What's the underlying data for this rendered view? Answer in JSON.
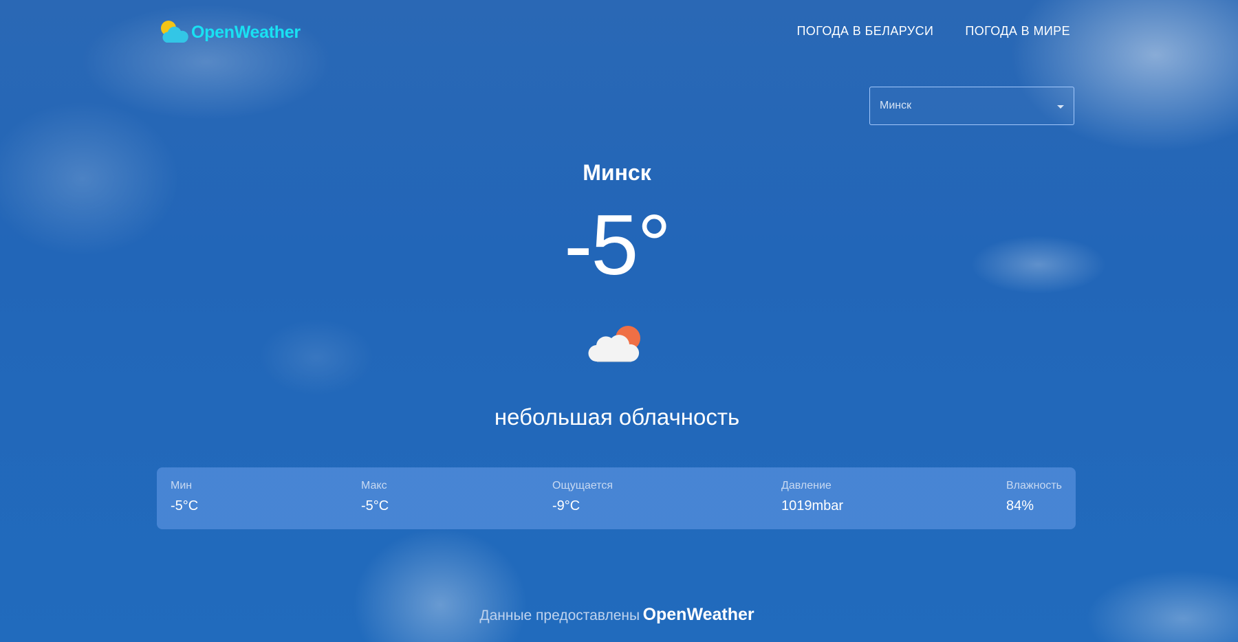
{
  "header": {
    "brand": "OpenWeather",
    "nav": [
      {
        "label": "ПОГОДА В БЕЛАРУСИ"
      },
      {
        "label": "ПОГОДА В МИРЕ"
      }
    ]
  },
  "city_select": {
    "value": "Минск"
  },
  "current": {
    "city": "Минск",
    "temperature": "-5°",
    "description": "небольшая облачность",
    "icon": "partly-cloudy-icon"
  },
  "stats": [
    {
      "label": "Мин",
      "value": "-5°C"
    },
    {
      "label": "Макс",
      "value": "-5°C"
    },
    {
      "label": "Ощущается",
      "value": "-9°C"
    },
    {
      "label": "Давление",
      "value": "1019mbar"
    },
    {
      "label": "Влажность",
      "value": "84%"
    }
  ],
  "footer": {
    "label": "Данные предоставлены",
    "brand": "OpenWeather"
  },
  "colors": {
    "brand_text": "#19e1f3",
    "logo_sun": "#f4c415",
    "logo_cloud": "#33c6e6",
    "icon_sun": "#ef6f45",
    "icon_cloud": "#f3f3f3",
    "background": "#2266b8"
  }
}
